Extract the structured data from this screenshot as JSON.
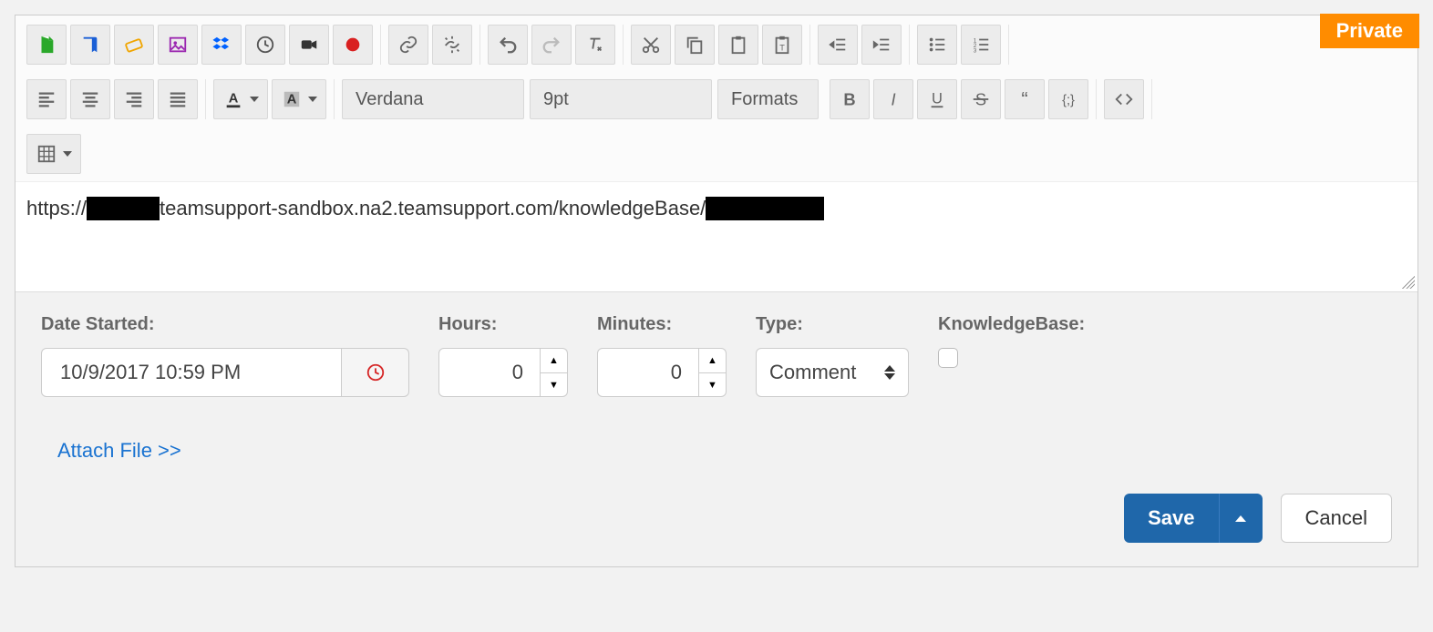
{
  "badge": {
    "private": "Private"
  },
  "toolbar": {
    "font_family": "Verdana",
    "font_size": "9pt",
    "formats_label": "Formats"
  },
  "editor": {
    "url_prefix": "https://",
    "url_mid": "teamsupport-sandbox.na2.teamsupport.com/knowledgeBase/"
  },
  "meta": {
    "date_started_label": "Date Started:",
    "date_started_value": "10/9/2017 10:59 PM",
    "hours_label": "Hours:",
    "hours_value": "0",
    "minutes_label": "Minutes:",
    "minutes_value": "0",
    "type_label": "Type:",
    "type_value": "Comment",
    "kb_label": "KnowledgeBase:"
  },
  "links": {
    "attach_file": "Attach File >>"
  },
  "actions": {
    "save": "Save",
    "cancel": "Cancel"
  }
}
